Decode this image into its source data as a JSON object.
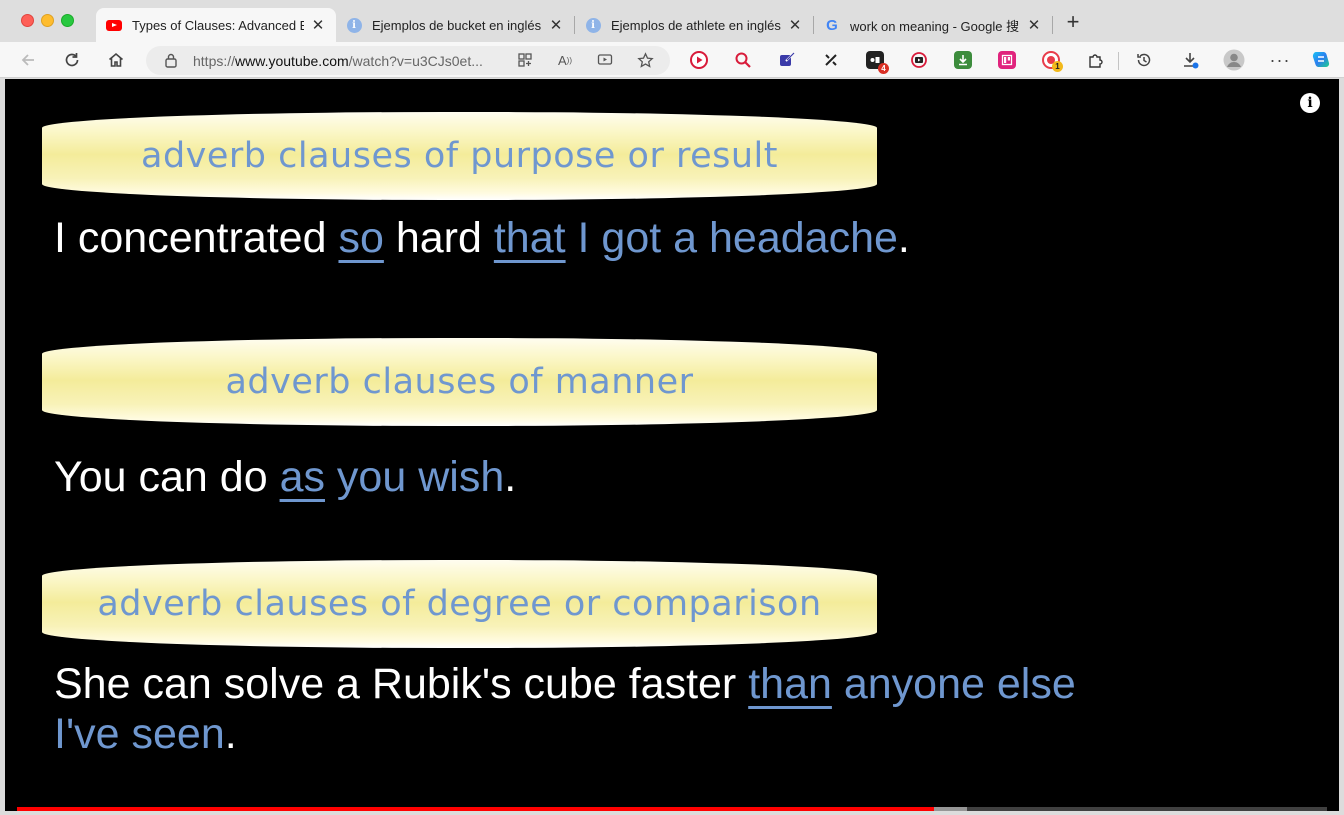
{
  "window": {
    "tabs": [
      {
        "title": "Types of Clauses: Advanced Er",
        "favicon": "youtube-icon",
        "active": true
      },
      {
        "title": "Ejemplos de bucket en inglés |",
        "favicon": "info-icon",
        "active": false
      },
      {
        "title": "Ejemplos de athlete en inglés |",
        "favicon": "info-icon",
        "active": false
      },
      {
        "title": "work on meaning - Google 搜索",
        "favicon": "google-icon",
        "active": false
      }
    ],
    "close_glyph": "✕",
    "new_tab_glyph": "+"
  },
  "toolbar": {
    "url_scheme": "https://",
    "url_host": "www.youtube.com",
    "url_path": "/watch?v=u3CJs0et...",
    "extension_badges": {
      "reader": "4",
      "record": "1"
    }
  },
  "video": {
    "info_glyph": "i",
    "progress": {
      "played_fraction": 0.7,
      "buffered_fraction": 0.725
    },
    "sections": [
      {
        "heading": "adverb clauses of purpose or result",
        "sentence": [
          {
            "text": "I concentrated ",
            "style": "plain"
          },
          {
            "text": "so",
            "style": "keyword"
          },
          {
            "text": " hard ",
            "style": "plain"
          },
          {
            "text": "that",
            "style": "keyword"
          },
          {
            "text": " I got a headache",
            "style": "clause"
          },
          {
            "text": ".",
            "style": "plain"
          }
        ]
      },
      {
        "heading": "adverb clauses of manner",
        "sentence": [
          {
            "text": "You can do ",
            "style": "plain"
          },
          {
            "text": "as",
            "style": "keyword"
          },
          {
            "text": " you wish",
            "style": "clause"
          },
          {
            "text": ".",
            "style": "plain"
          }
        ]
      },
      {
        "heading": "adverb clauses of degree or comparison",
        "sentence_line1": [
          {
            "text": "She can solve a Rubik's cube faster ",
            "style": "plain"
          },
          {
            "text": "than",
            "style": "keyword"
          },
          {
            "text": " anyone else",
            "style": "clause"
          }
        ],
        "sentence_line2": [
          {
            "text": "I've seen",
            "style": "clause"
          },
          {
            "text": ".",
            "style": "plain"
          }
        ]
      }
    ]
  },
  "colors": {
    "highlight_blue": "#6f97cf",
    "youtube_red": "#ff0000"
  }
}
